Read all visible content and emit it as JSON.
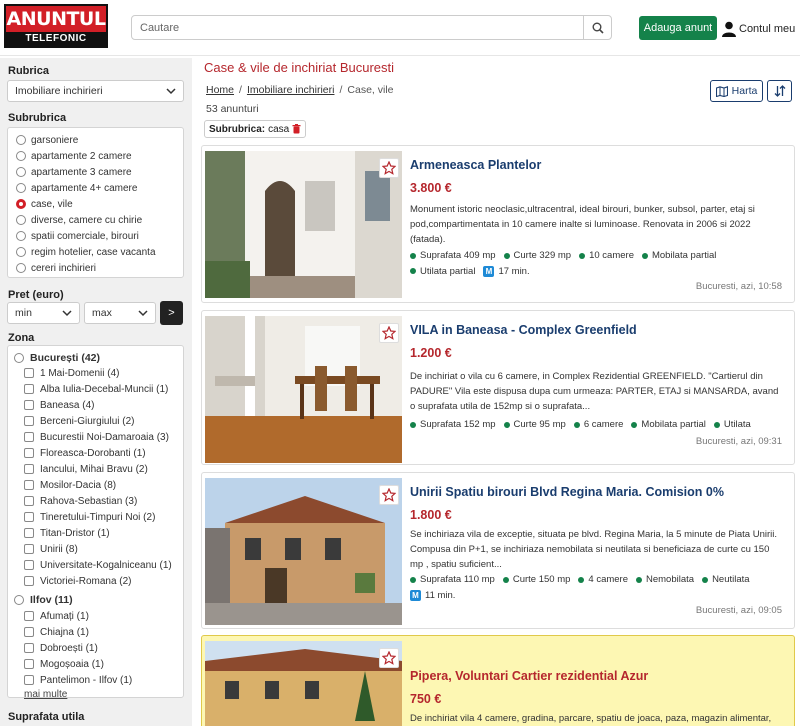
{
  "header": {
    "logo_top": "ANUNTUL",
    "logo_bottom": "TELEFONIC",
    "search_placeholder": "Cautare",
    "add_button": "Adauga anunt",
    "account_label": "Contul meu"
  },
  "sidebar": {
    "rubrica_label": "Rubrica",
    "rubrica_value": "Imobiliare inchirieri",
    "subrubrica_label": "Subrubrica",
    "subrubrici": [
      {
        "label": "garsoniere",
        "selected": false
      },
      {
        "label": "apartamente 2 camere",
        "selected": false
      },
      {
        "label": "apartamente 3 camere",
        "selected": false
      },
      {
        "label": "apartamente 4+ camere",
        "selected": false
      },
      {
        "label": "case, vile",
        "selected": true
      },
      {
        "label": "diverse, camere cu chirie",
        "selected": false
      },
      {
        "label": "spatii comerciale, birouri",
        "selected": false
      },
      {
        "label": "regim hotelier, case vacanta",
        "selected": false
      },
      {
        "label": "cereri inchirieri",
        "selected": false
      }
    ],
    "price_label": "Pret (euro)",
    "price_min": "min",
    "price_max": "max",
    "price_go": ">",
    "zona_label": "Zona",
    "zones": [
      {
        "label": "București (42)",
        "group": true
      },
      {
        "label": "1 Mai-Domenii (4)",
        "group": false
      },
      {
        "label": "Alba Iulia-Decebal-Muncii (1)",
        "group": false
      },
      {
        "label": "Baneasa (4)",
        "group": false
      },
      {
        "label": "Berceni-Giurgiului (2)",
        "group": false
      },
      {
        "label": "Bucurestii Noi-Damaroaia (3)",
        "group": false
      },
      {
        "label": "Floreasca-Dorobanti (1)",
        "group": false
      },
      {
        "label": "Iancului, Mihai Bravu (2)",
        "group": false
      },
      {
        "label": "Mosilor-Dacia (8)",
        "group": false
      },
      {
        "label": "Rahova-Sebastian (3)",
        "group": false
      },
      {
        "label": "Tineretului-Timpuri Noi (2)",
        "group": false
      },
      {
        "label": "Titan-Dristor (1)",
        "group": false
      },
      {
        "label": "Unirii (8)",
        "group": false
      },
      {
        "label": "Universitate-Kogalniceanu (1)",
        "group": false
      },
      {
        "label": "Victoriei-Romana (2)",
        "group": false
      },
      {
        "label": "Ilfov (11)",
        "group": true
      },
      {
        "label": "Afumați (1)",
        "group": false
      },
      {
        "label": "Chiajna (1)",
        "group": false
      },
      {
        "label": "Dobroești (1)",
        "group": false
      },
      {
        "label": "Mogoșoaia (1)",
        "group": false
      },
      {
        "label": "Pantelimon - Ilfov (1)",
        "group": false
      }
    ],
    "more_link": "mai multe",
    "suprafata_label": "Suprafata utila"
  },
  "main": {
    "title": "Case & vile de inchiriat Bucuresti",
    "breadcrumb": [
      "Home",
      "Imobiliare inchirieri",
      "Case, vile"
    ],
    "count": "53 anunturi",
    "filter_label": "Subrubrica:",
    "filter_value": "casa",
    "map_button": "Harta"
  },
  "listings": [
    {
      "title": "Armeneasca Plantelor",
      "price": "3.800 €",
      "description": "Monument istoric neoclasic,ultracentral, ideal birouri, bunker, subsol, parter, etaj si pod,compartimentata in 10 camere inalte si luminoase. Renovata in 2006 si 2022 (fatada).",
      "features": [
        "Suprafata 409 mp",
        "Curte 329 mp",
        "10 camere",
        "Mobilata partial",
        "Utilata partial"
      ],
      "metro": "17 min.",
      "meta": "Bucuresti, azi, 10:58",
      "highlight": false
    },
    {
      "title": "VILA in Baneasa - Complex Greenfield",
      "price": "1.200 €",
      "description": "De inchiriat o vila cu 6 camere, in Complex Rezidential GREENFIELD. \"Cartierul din PADURE\" Vila este dispusa dupa cum urmeaza: PARTER, ETAJ si MANSARDA, avand o suprafata utila de 152mp si o suprafata...",
      "features": [
        "Suprafata 152 mp",
        "Curte 95 mp",
        "6 camere",
        "Mobilata partial",
        "Utilata"
      ],
      "metro": "",
      "meta": "Bucuresti, azi, 09:31",
      "highlight": false
    },
    {
      "title": "Unirii Spatiu birouri Blvd Regina Maria. Comision 0%",
      "price": "1.800 €",
      "description": "Se inchiriaza vila de exceptie, situata pe blvd. Regina Maria, la 5 minute de Piata Unirii. Compusa din P+1, se inchiriaza nemobilata si neutilata si beneficiaza de curte cu 150 mp , spatiu suficient...",
      "features": [
        "Suprafata 110 mp",
        "Curte 150 mp",
        "4 camere",
        "Nemobilata",
        "Neutilata"
      ],
      "metro": "11 min.",
      "meta": "Bucuresti, azi, 09:05",
      "highlight": false
    },
    {
      "title": "Pipera, Voluntari Cartier rezidential Azur",
      "price": "750 €",
      "description": "De inchiriat vila 4 camere, gradina, parcare, spatiu de joaca, paza, magazin alimentar,",
      "features": [],
      "metro": "",
      "meta": "",
      "highlight": true
    }
  ],
  "colors": {
    "brand_red": "#d21f27",
    "green": "#14824a",
    "navy": "#1a3d6e",
    "highlight": "#fdf7b3"
  }
}
